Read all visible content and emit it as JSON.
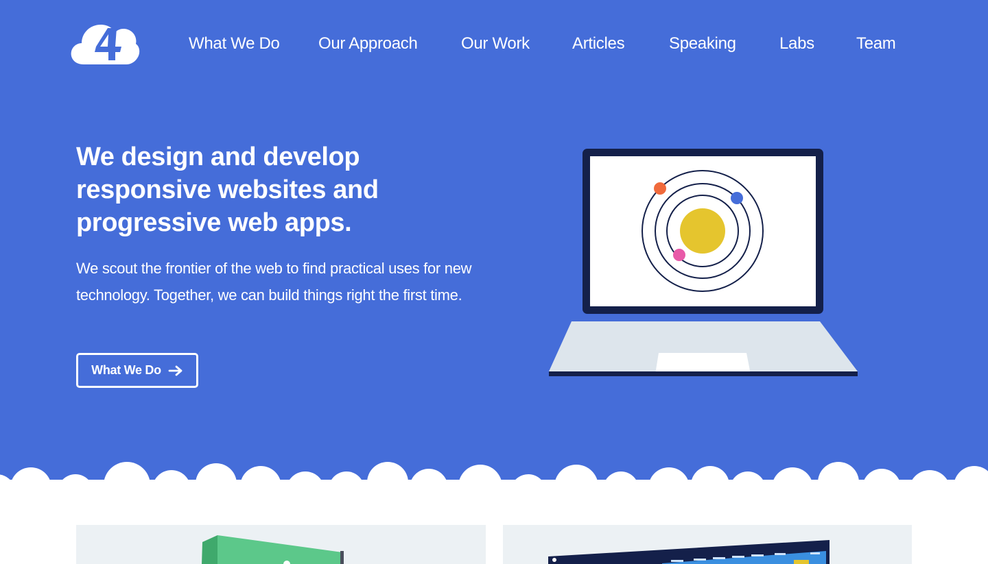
{
  "nav": {
    "items": [
      {
        "label": "What We Do"
      },
      {
        "label": "Our Approach"
      },
      {
        "label": "Our Work"
      },
      {
        "label": "Articles"
      },
      {
        "label": "Speaking"
      },
      {
        "label": "Labs"
      },
      {
        "label": "Team"
      }
    ]
  },
  "logo": {
    "text": "4",
    "icon": "cloud-4-logo"
  },
  "hero": {
    "headline": "We design and develop responsive websites and progressive web apps.",
    "subtext": "We scout the frontier of the web to find practical uses for new technology. Together, we can build things right the first time.",
    "cta_label": "What We Do",
    "cta_icon": "arrow-right-icon"
  },
  "colors": {
    "brand_blue": "#456DD9",
    "navy": "#14204A",
    "sun_yellow": "#E5C52E",
    "planet_orange": "#F06A3C",
    "planet_blue": "#456DD9",
    "planet_pink": "#E85AA8",
    "laptop_base": "#DDE5EC",
    "card_bg": "#ECF1F4",
    "card_green": "#5CC88A"
  }
}
